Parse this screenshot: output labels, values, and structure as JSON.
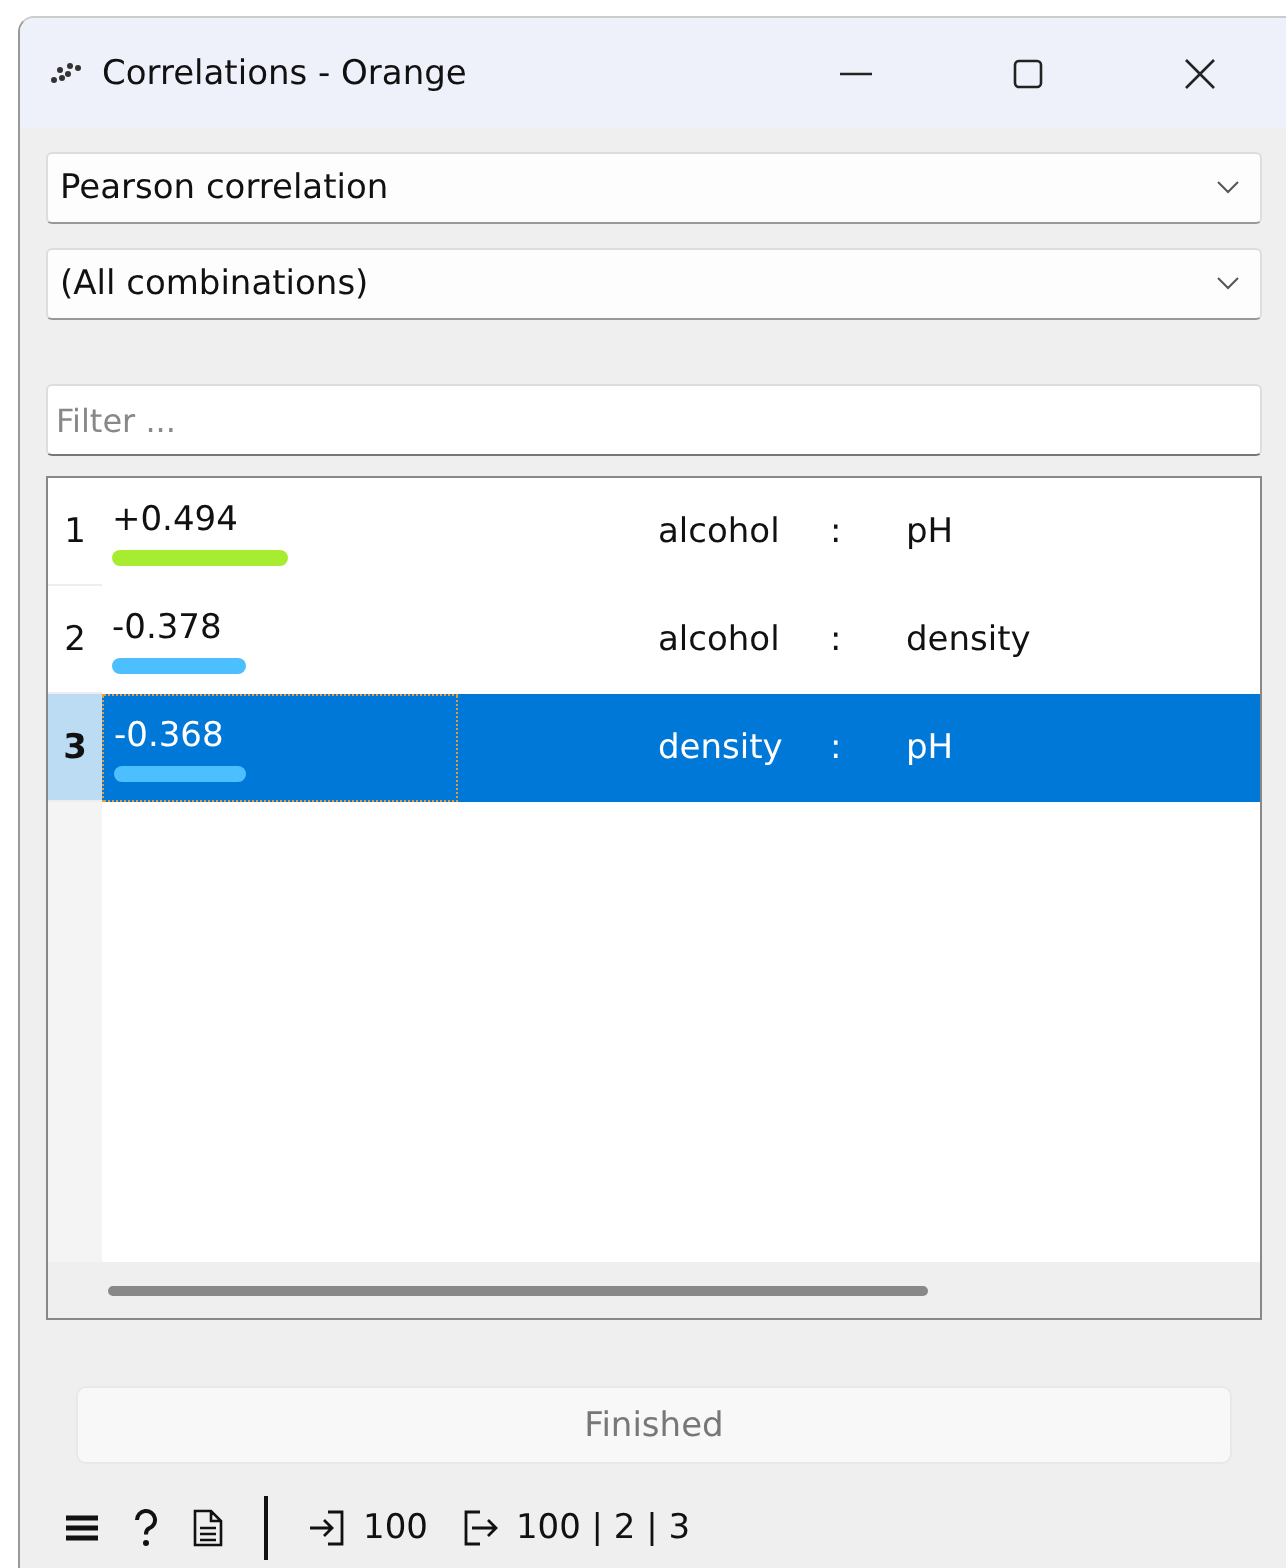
{
  "window": {
    "title": "Correlations - Orange"
  },
  "correlation_type": {
    "value": "Pearson correlation"
  },
  "feature": {
    "value": "(All combinations)"
  },
  "filter": {
    "placeholder": "Filter ..."
  },
  "rows": [
    {
      "index": "1",
      "value": "+0.494",
      "color": "#a6ed32",
      "attribute_1": "alcohol",
      "separator": ":",
      "attribute_2": "pH",
      "selected": false
    },
    {
      "index": "2",
      "value": "-0.378",
      "color": "#4cbfff",
      "attribute_1": "alcohol",
      "separator": ":",
      "attribute_2": "density",
      "selected": false
    },
    {
      "index": "3",
      "value": "-0.368",
      "color": "#4cbfff",
      "attribute_1": "density",
      "separator": ":",
      "attribute_2": "pH",
      "selected": true
    }
  ],
  "status_button": {
    "label": "Finished",
    "disabled": true
  },
  "status_bar": {
    "input_count": "100",
    "output_count": "100 | 2 | 3"
  }
}
